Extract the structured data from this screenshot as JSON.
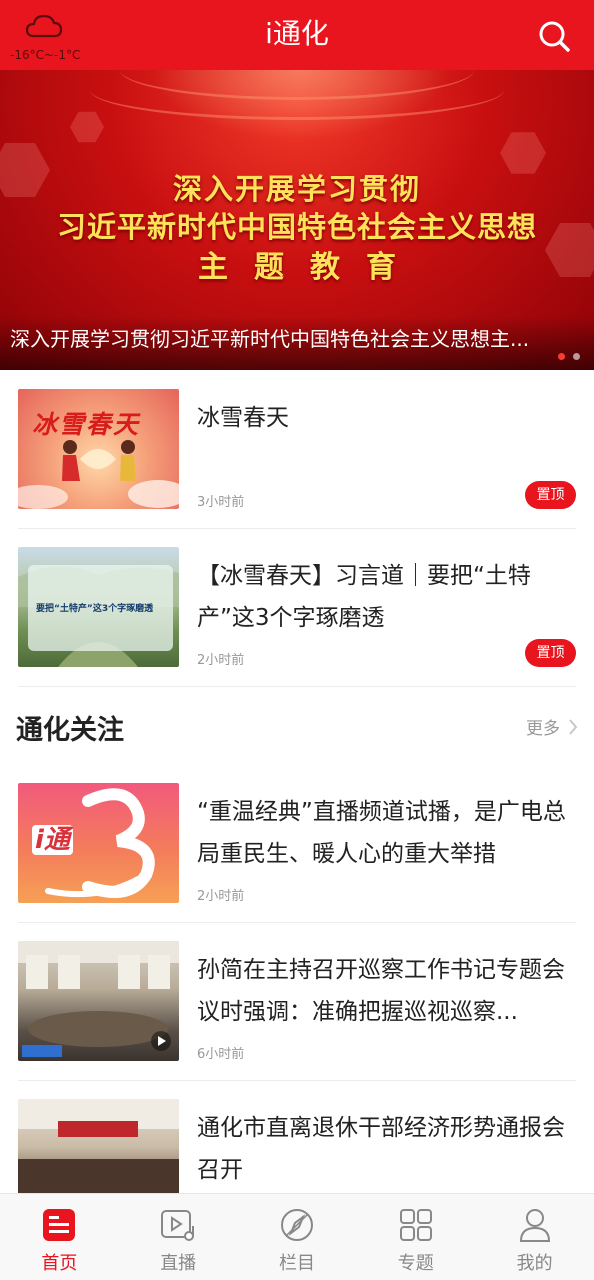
{
  "header": {
    "title": "i通化",
    "weather_temp": "-16°C~-1°C",
    "weather_icon": "cloud-icon",
    "search_icon": "search-icon"
  },
  "banner": {
    "headline_line1": "深入开展学习贯彻",
    "headline_line2": "习近平新时代中国特色社会主义思想",
    "headline_line3": "主题教育",
    "caption": "深入开展学习贯彻习近平新时代中国特色社会主义思想主...",
    "slide_count": 2,
    "active_slide": 1
  },
  "top_news": [
    {
      "title": "冰雪春天",
      "time": "3小时前",
      "badge": "置顶",
      "thumb_text": "冰雪春天"
    },
    {
      "title": "【冰雪春天】习言道｜要把“土特产”这3个字琢磨透",
      "time": "2小时前",
      "badge": "置顶",
      "thumb_text": "要把“土特产”这3个字琢磨透"
    }
  ],
  "section": {
    "title": "通化关注",
    "more_label": "更多"
  },
  "focus_news": [
    {
      "title": "“重温经典”直播频道试播，是广电总局重民生、暖人心的重大举措",
      "time": "2小时前",
      "thumb_text": "i通"
    },
    {
      "title": "孙简在主持召开巡察工作书记专题会议时强调：准确把握巡视巡察...",
      "time": "6小时前"
    },
    {
      "title": "通化市直离退休干部经济形势通报会召开"
    }
  ],
  "bottom_nav": [
    {
      "label": "首页",
      "icon": "news-icon",
      "active": true
    },
    {
      "label": "直播",
      "icon": "live-video-icon",
      "active": false
    },
    {
      "label": "栏目",
      "icon": "compass-icon",
      "active": false
    },
    {
      "label": "专题",
      "icon": "grid-icon",
      "active": false
    },
    {
      "label": "我的",
      "icon": "user-icon",
      "active": false
    }
  ],
  "colors": {
    "brand_red": "#e8141e",
    "banner_text": "#ffe15a",
    "muted_text": "#999999"
  }
}
